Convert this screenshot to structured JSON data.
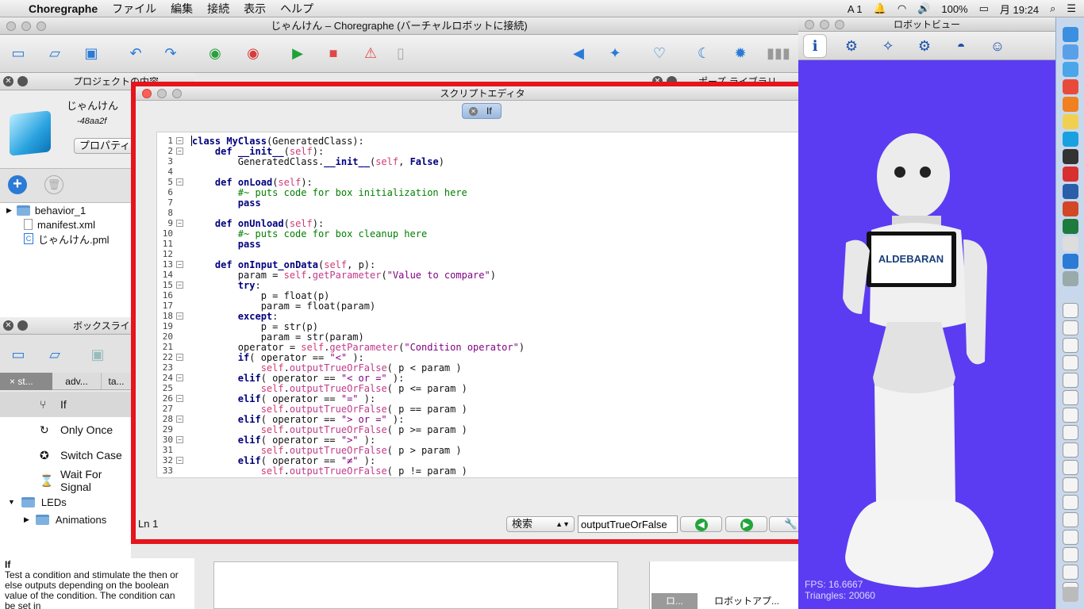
{
  "menubar": {
    "apple": "",
    "app": "Choregraphe",
    "items": [
      "ファイル",
      "編集",
      "接続",
      "表示",
      "ヘルプ"
    ],
    "right": {
      "input": "A 1",
      "battery": "100%",
      "clock": "月 19:24"
    }
  },
  "main_window": {
    "title": "じゃんけん – Choregraphe (バーチャルロボットに接続)"
  },
  "project_panel": {
    "header": "プロジェクトの内容",
    "project_name": "じゃんけん",
    "project_id": "-48aa2f",
    "properties_button": "プロパティ",
    "files": [
      "behavior_1",
      "manifest.xml",
      "じゃんけん.pml"
    ]
  },
  "box_library": {
    "header": "ボックスライブラリ",
    "tabs": [
      "st...",
      "adv...",
      "ta..."
    ],
    "items": [
      "If",
      "Only Once",
      "Switch Case",
      "Wait For Signal"
    ],
    "folders": [
      "LEDs",
      "Animations"
    ],
    "description_title": "If",
    "description": "Test a condition and stimulate the then or else outputs depending on the boolean value of the condition. The condition can be set in"
  },
  "pose_library": {
    "header": "ポーズ ライブラリ",
    "tabs": [
      "ロ...",
      "ロボットアプ..."
    ]
  },
  "script_editor": {
    "title": "スクリプトエディタ",
    "tab": "If",
    "status": "Ln 1",
    "search_mode": "検索",
    "search_value": "outputTrueOrFalse"
  },
  "code_lines": [
    "class MyClass(GeneratedClass):",
    "    def __init__(self):",
    "        GeneratedClass.__init__(self, False)",
    "",
    "    def onLoad(self):",
    "        #~ puts code for box initialization here",
    "        pass",
    "",
    "    def onUnload(self):",
    "        #~ puts code for box cleanup here",
    "        pass",
    "",
    "    def onInput_onData(self, p):",
    "        param = self.getParameter(\"Value to compare\")",
    "        try:",
    "            p = float(p)",
    "            param = float(param)",
    "        except:",
    "            p = str(p)",
    "            param = str(param)",
    "        operator = self.getParameter(\"Condition operator\")",
    "        if( operator == \"<\" ):",
    "            self.outputTrueOrFalse( p < param )",
    "        elif( operator == \"< or =\" ):",
    "            self.outputTrueOrFalse( p <= param )",
    "        elif( operator == \"=\" ):",
    "            self.outputTrueOrFalse( p == param )",
    "        elif( operator == \"> or =\" ):",
    "            self.outputTrueOrFalse( p >= param )",
    "        elif( operator == \">\" ):",
    "            self.outputTrueOrFalse( p > param )",
    "        elif( operator == \"≠\" ):",
    "            self.outputTrueOrFalse( p != param )"
  ],
  "fold_lines": [
    1,
    2,
    5,
    9,
    13,
    15,
    18,
    22,
    24,
    26,
    28,
    30,
    32
  ],
  "robot_view": {
    "title": "ロボットビュー",
    "screen_logo": "ALDEBARAN",
    "fps": "FPS: 16.6667",
    "triangles": "Triangles: 20060",
    "background": "#5b3cf2"
  }
}
